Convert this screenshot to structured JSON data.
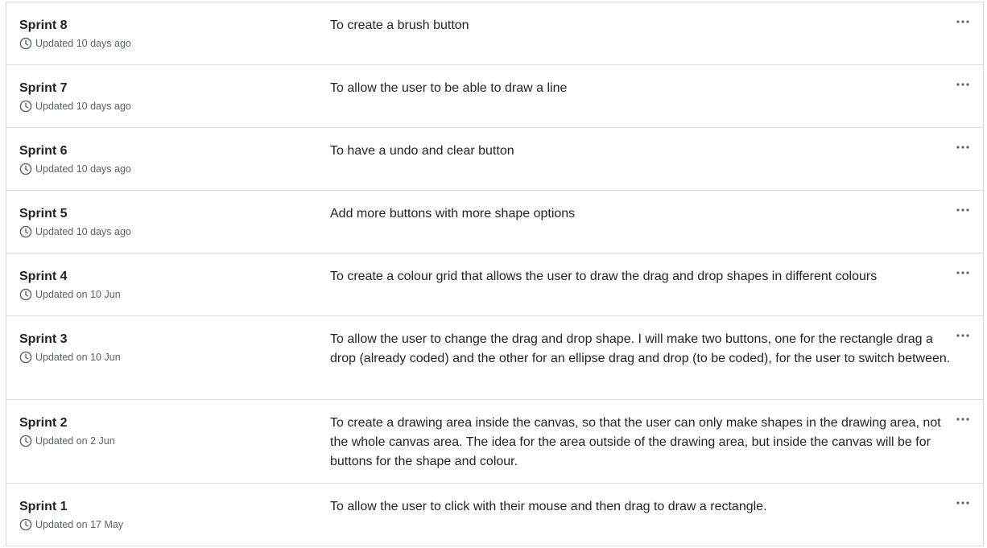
{
  "milestones": [
    {
      "name": "Sprint 8",
      "updated": "Updated 10 days ago",
      "description": "To create a brush button"
    },
    {
      "name": "Sprint 7",
      "updated": "Updated 10 days ago",
      "description": "To allow the user to be able to draw a line"
    },
    {
      "name": "Sprint 6",
      "updated": "Updated 10 days ago",
      "description": "To have a undo and clear button"
    },
    {
      "name": "Sprint 5",
      "updated": "Updated 10 days ago",
      "description": "Add more buttons with more shape options"
    },
    {
      "name": "Sprint 4",
      "updated": "Updated on 10 Jun",
      "description": "To create a colour grid that allows the user to draw the drag and drop shapes in different colours"
    },
    {
      "name": "Sprint 3",
      "updated": "Updated on 10 Jun",
      "description": "To allow the user to change the drag and drop shape. I will make two buttons, one for the rectangle drag a drop (already coded) and the other for an ellipse drag and drop (to be coded), for the user to switch between."
    },
    {
      "name": "Sprint 2",
      "updated": "Updated on 2 Jun",
      "description": "To create a drawing area inside the canvas, so that the user can only make shapes in the drawing area, not the whole canvas area. The idea for the area outside of the drawing area, but inside the canvas will be for buttons for the shape and colour."
    },
    {
      "name": "Sprint 1",
      "updated": "Updated on 17 May",
      "description": "To allow the user to click with their mouse and then drag to draw a rectangle."
    }
  ],
  "icons": {
    "updated": "clock-icon",
    "row_menu": "kebab-horizontal-icon"
  }
}
